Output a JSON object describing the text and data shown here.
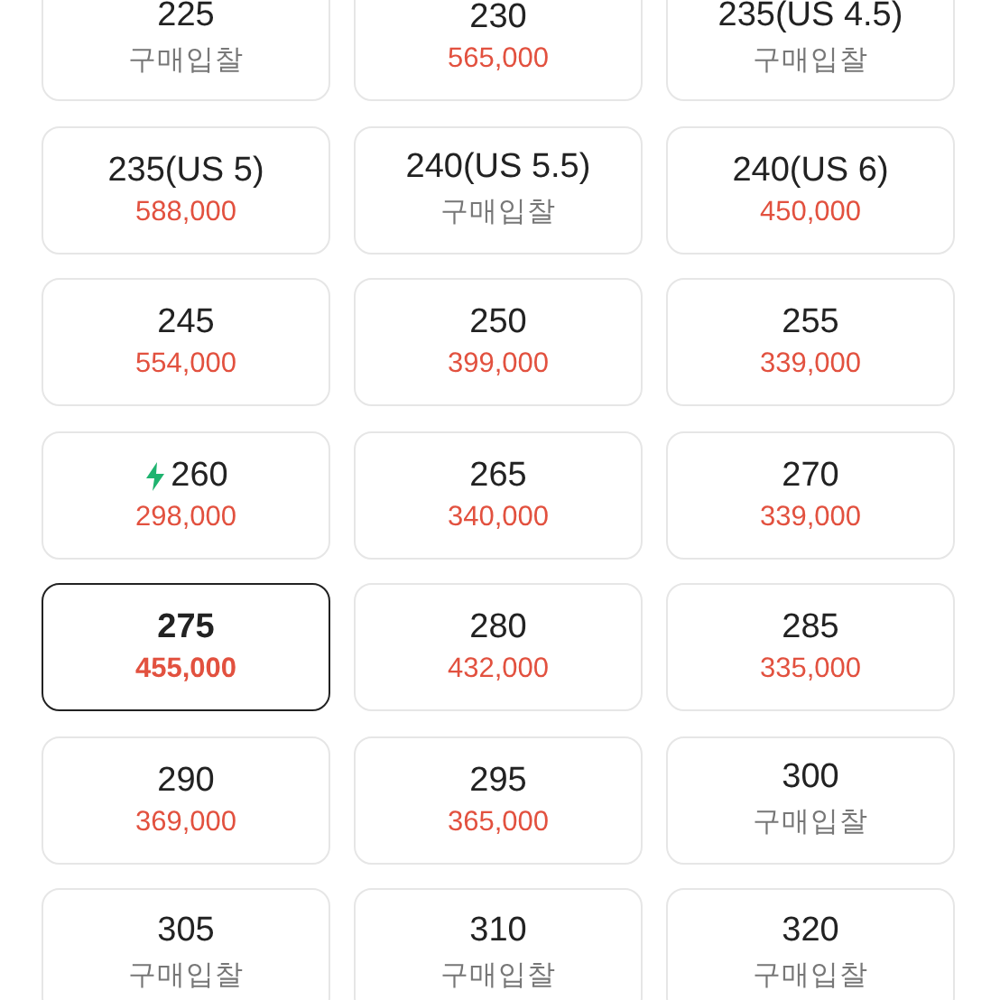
{
  "sizes": [
    {
      "size": "225",
      "price": "구매입찰",
      "kind": "bid",
      "fast": false,
      "selected": false
    },
    {
      "size": "230",
      "price": "565,000",
      "kind": "price",
      "fast": false,
      "selected": false
    },
    {
      "size": "235(US 4.5)",
      "price": "구매입찰",
      "kind": "bid",
      "fast": false,
      "selected": false
    },
    {
      "size": "235(US 5)",
      "price": "588,000",
      "kind": "price",
      "fast": false,
      "selected": false
    },
    {
      "size": "240(US 5.5)",
      "price": "구매입찰",
      "kind": "bid",
      "fast": false,
      "selected": false
    },
    {
      "size": "240(US 6)",
      "price": "450,000",
      "kind": "price",
      "fast": false,
      "selected": false
    },
    {
      "size": "245",
      "price": "554,000",
      "kind": "price",
      "fast": false,
      "selected": false
    },
    {
      "size": "250",
      "price": "399,000",
      "kind": "price",
      "fast": false,
      "selected": false
    },
    {
      "size": "255",
      "price": "339,000",
      "kind": "price",
      "fast": false,
      "selected": false
    },
    {
      "size": "260",
      "price": "298,000",
      "kind": "price",
      "fast": true,
      "selected": false
    },
    {
      "size": "265",
      "price": "340,000",
      "kind": "price",
      "fast": false,
      "selected": false
    },
    {
      "size": "270",
      "price": "339,000",
      "kind": "price",
      "fast": false,
      "selected": false
    },
    {
      "size": "275",
      "price": "455,000",
      "kind": "price",
      "fast": false,
      "selected": true
    },
    {
      "size": "280",
      "price": "432,000",
      "kind": "price",
      "fast": false,
      "selected": false
    },
    {
      "size": "285",
      "price": "335,000",
      "kind": "price",
      "fast": false,
      "selected": false
    },
    {
      "size": "290",
      "price": "369,000",
      "kind": "price",
      "fast": false,
      "selected": false
    },
    {
      "size": "295",
      "price": "365,000",
      "kind": "price",
      "fast": false,
      "selected": false
    },
    {
      "size": "300",
      "price": "구매입찰",
      "kind": "bid",
      "fast": false,
      "selected": false
    },
    {
      "size": "305",
      "price": "구매입찰",
      "kind": "bid",
      "fast": false,
      "selected": false
    },
    {
      "size": "310",
      "price": "구매입찰",
      "kind": "bid",
      "fast": false,
      "selected": false
    },
    {
      "size": "320",
      "price": "구매입찰",
      "kind": "bid",
      "fast": false,
      "selected": false
    }
  ]
}
